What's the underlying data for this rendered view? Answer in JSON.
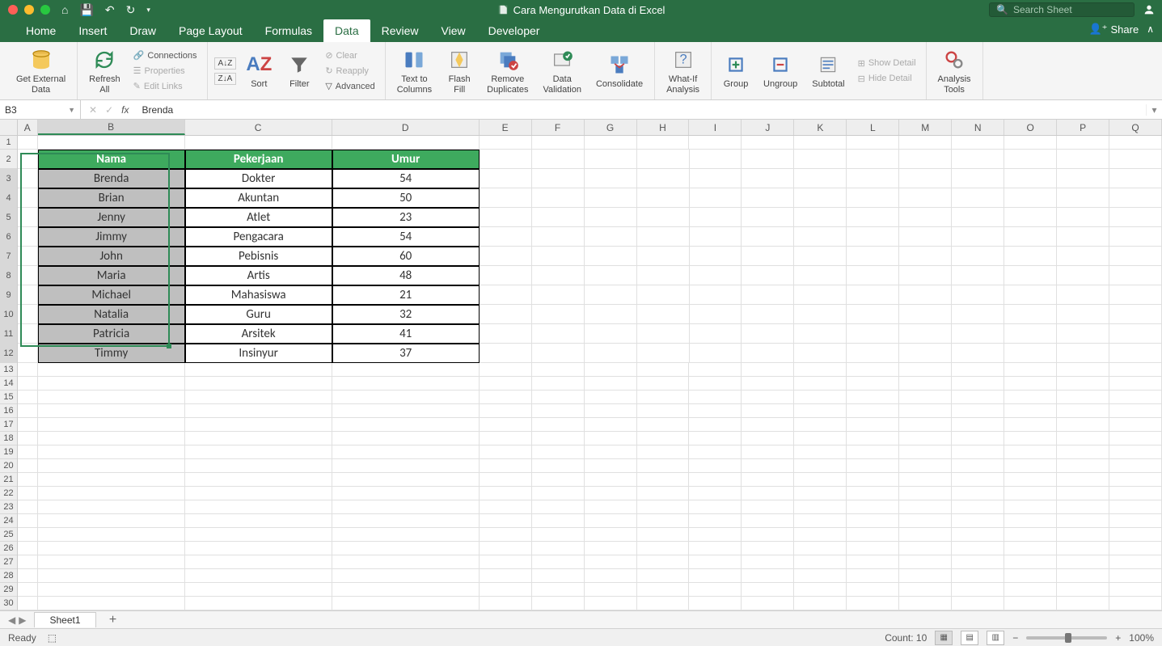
{
  "window": {
    "title": "Cara Mengurutkan Data di Excel"
  },
  "search": {
    "placeholder": "Search Sheet"
  },
  "share_label": "Share",
  "tabs": [
    "Home",
    "Insert",
    "Draw",
    "Page Layout",
    "Formulas",
    "Data",
    "Review",
    "View",
    "Developer"
  ],
  "active_tab": "Data",
  "ribbon": {
    "get_external": "Get External\nData",
    "refresh_all": "Refresh\nAll",
    "connections": "Connections",
    "properties": "Properties",
    "edit_links": "Edit Links",
    "sort": "Sort",
    "filter": "Filter",
    "clear": "Clear",
    "reapply": "Reapply",
    "advanced": "Advanced",
    "text_to_columns": "Text to\nColumns",
    "flash_fill": "Flash\nFill",
    "remove_duplicates": "Remove\nDuplicates",
    "data_validation": "Data\nValidation",
    "consolidate": "Consolidate",
    "whatif": "What-If\nAnalysis",
    "group": "Group",
    "ungroup": "Ungroup",
    "subtotal": "Subtotal",
    "show_detail": "Show Detail",
    "hide_detail": "Hide Detail",
    "analysis_tools": "Analysis\nTools"
  },
  "namebox": "B3",
  "formula": "Brenda",
  "columns": [
    "A",
    "B",
    "C",
    "D",
    "E",
    "F",
    "G",
    "H",
    "I",
    "J",
    "K",
    "L",
    "M",
    "N",
    "O",
    "P",
    "Q"
  ],
  "table": {
    "headers": [
      "Nama",
      "Pekerjaan",
      "Umur"
    ],
    "rows": [
      [
        "Brenda",
        "Dokter",
        "54"
      ],
      [
        "Brian",
        "Akuntan",
        "50"
      ],
      [
        "Jenny",
        "Atlet",
        "23"
      ],
      [
        "Jimmy",
        "Pengacara",
        "54"
      ],
      [
        "John",
        "Pebisnis",
        "60"
      ],
      [
        "Maria",
        "Artis",
        "48"
      ],
      [
        "Michael",
        "Mahasiswa",
        "21"
      ],
      [
        "Natalia",
        "Guru",
        "32"
      ],
      [
        "Patricia",
        "Arsitek",
        "41"
      ],
      [
        "Timmy",
        "Insinyur",
        "37"
      ]
    ]
  },
  "sheet_tab": "Sheet1",
  "status": {
    "ready": "Ready",
    "count": "Count: 10",
    "zoom": "100%"
  }
}
